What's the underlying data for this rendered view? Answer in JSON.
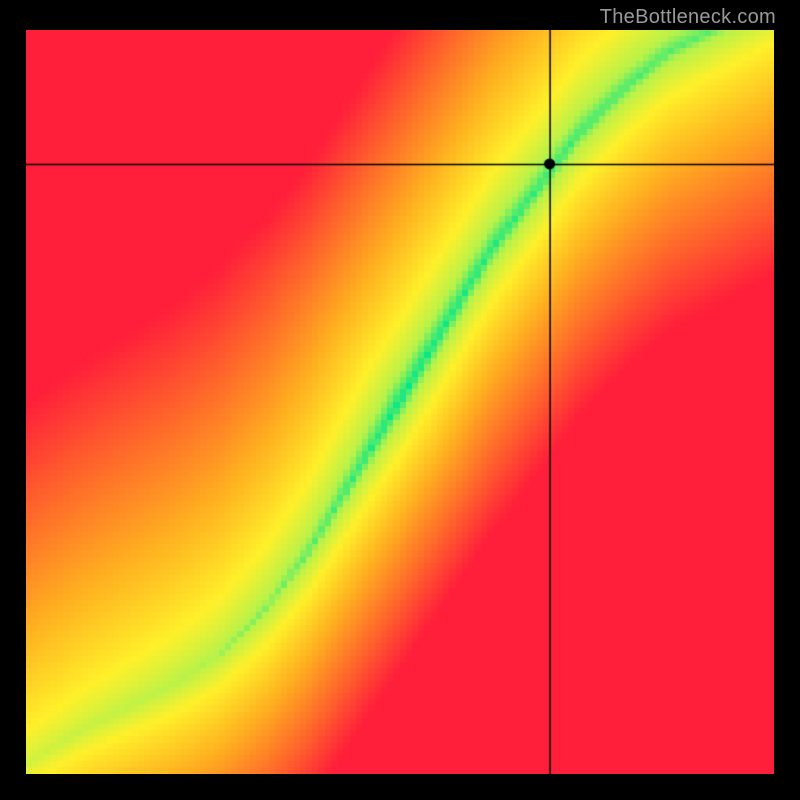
{
  "watermark": "TheBottleneck.com",
  "chart_data": {
    "type": "heatmap",
    "title": "",
    "xlabel": "",
    "ylabel": "",
    "xlim": [
      0,
      100
    ],
    "ylim": [
      0,
      100
    ],
    "marker": {
      "x": 70,
      "y": 82,
      "comment": "black crosshair point (percent of plot area from bottom-left)"
    },
    "optimal_curve": {
      "comment": "approximate centerline of the green optimal-band, as (x%, y%) from bottom-left",
      "points": [
        [
          3,
          3
        ],
        [
          8,
          6
        ],
        [
          14,
          9
        ],
        [
          20,
          12
        ],
        [
          26,
          16
        ],
        [
          32,
          22
        ],
        [
          38,
          30
        ],
        [
          44,
          40
        ],
        [
          50,
          50
        ],
        [
          56,
          60
        ],
        [
          62,
          70
        ],
        [
          68,
          78
        ],
        [
          74,
          86
        ],
        [
          80,
          92
        ],
        [
          86,
          97
        ],
        [
          92,
          100
        ]
      ]
    },
    "color_scale": {
      "comment": "qualitative mapping from distance-to-optimal to color",
      "stops": [
        {
          "dist": 0.0,
          "color": "#00e68a"
        },
        {
          "dist": 0.1,
          "color": "#b8f24a"
        },
        {
          "dist": 0.25,
          "color": "#fff02a"
        },
        {
          "dist": 0.5,
          "color": "#ffb020"
        },
        {
          "dist": 0.75,
          "color": "#ff6a2a"
        },
        {
          "dist": 1.0,
          "color": "#ff1f3a"
        }
      ]
    },
    "resolution": 120
  }
}
